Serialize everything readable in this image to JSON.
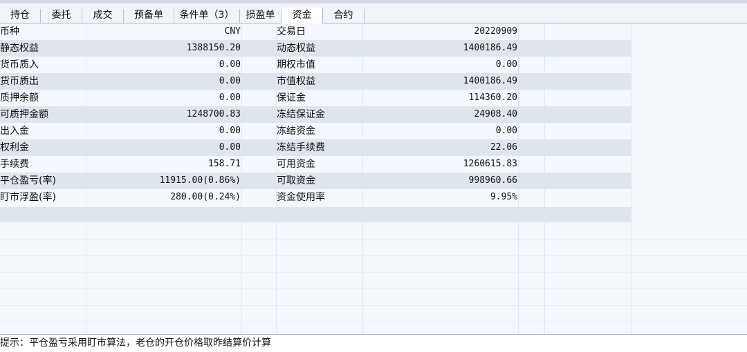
{
  "tabs": [
    "持仓",
    "委托",
    "成交",
    "预备单",
    "条件单（3）",
    "损盈单",
    "资金",
    "合约"
  ],
  "active_tab": "资金",
  "rows": [
    {
      "l1": "币种",
      "v1": "CNY",
      "l2": "交易日",
      "v2": "20220909"
    },
    {
      "l1": "静态权益",
      "v1": "1388150.20",
      "l2": "动态权益",
      "v2": "1400186.49"
    },
    {
      "l1": "货币质入",
      "v1": "0.00",
      "l2": "期权市值",
      "v2": "0.00"
    },
    {
      "l1": "货币质出",
      "v1": "0.00",
      "l2": "市值权益",
      "v2": "1400186.49"
    },
    {
      "l1": "质押余额",
      "v1": "0.00",
      "l2": "保证金",
      "v2": "114360.20"
    },
    {
      "l1": "可质押金额",
      "v1": "1248700.83",
      "l2": "冻结保证金",
      "v2": "24908.40"
    },
    {
      "l1": "出入金",
      "v1": "0.00",
      "l2": "冻结资金",
      "v2": "0.00"
    },
    {
      "l1": "权利金",
      "v1": "0.00",
      "l2": "冻结手续费",
      "v2": "22.06"
    },
    {
      "l1": "手续费",
      "v1": "158.71",
      "l2": "可用资金",
      "v2": "1260615.83"
    },
    {
      "l1": "平仓盈亏(率)",
      "v1": "11915.00(0.86%)",
      "l2": "可取资金",
      "v2": "998960.66"
    },
    {
      "l1": "盯市浮盈(率)",
      "v1": "280.00(0.24%)",
      "l2": "资金使用率",
      "v2": "9.95%"
    }
  ],
  "status": {
    "text": "提示：平仓盈亏采用盯市算法，老仓的开仓价格取昨结算价计算"
  }
}
